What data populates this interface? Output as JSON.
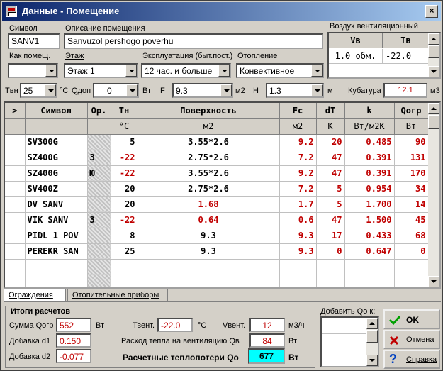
{
  "window": {
    "title": "Данные - Помещение",
    "close": "×"
  },
  "top": {
    "symbol_label": "Символ",
    "symbol_value": "SANV1",
    "desc_label": "Описание помещения",
    "desc_value": "Sanvuzol pershogo poverhu",
    "kak_label": "Как помещ.",
    "kak_value": "",
    "floor_label": "Этаж",
    "floor_value": "Этаж 1",
    "expl_label": "Эксплуатация (быт.пост.)",
    "expl_value": "12 час. и больше",
    "heat_label": "Отопление",
    "heat_value": "Конвективное"
  },
  "vent": {
    "title": "Воздух вентиляционный",
    "col1": "Vв",
    "col2": "Tв",
    "val1": "1.0 обм.",
    "val2": "-22.0"
  },
  "params": {
    "tvn_label": "Tвн",
    "tvn_value": "25",
    "tvn_unit": "°C",
    "qdop_label": "Qдоп",
    "qdop_value": "0",
    "qdop_unit": "Вт",
    "f_label": "F",
    "f_value": "9.3",
    "f_unit": "м2",
    "h_label": "H",
    "h_value": "1.3",
    "h_unit": "м",
    "kub_label": "Кубатура",
    "kub_value": "12.1",
    "kub_unit": "м3"
  },
  "table": {
    "headers": [
      ">",
      "Символ",
      "Ор.",
      "Tн",
      "Поверхность",
      "Fc",
      "dT",
      "k",
      "Qогр"
    ],
    "units": [
      "",
      "",
      "",
      "°C",
      "м2",
      "м2",
      "K",
      "Вт/м2K",
      "Вт"
    ],
    "rows": [
      {
        "symbol": "SV300G",
        "or": "",
        "tn": "5",
        "surface": "3.55*2.6",
        "fc": "9.2",
        "dt": "20",
        "k": "0.485",
        "q": "90"
      },
      {
        "symbol": "SZ400G",
        "or": "З",
        "tn": "-22",
        "surface": "2.75*2.6",
        "fc": "7.2",
        "dt": "47",
        "k": "0.391",
        "q": "131"
      },
      {
        "symbol": "SZ400G",
        "or": "Ю",
        "tn": "-22",
        "surface": "3.55*2.6",
        "fc": "9.2",
        "dt": "47",
        "k": "0.391",
        "q": "170"
      },
      {
        "symbol": "SV400Z",
        "or": "",
        "tn": "20",
        "surface": "2.75*2.6",
        "fc": "7.2",
        "dt": "5",
        "k": "0.954",
        "q": "34"
      },
      {
        "symbol": "DV SANV",
        "or": "",
        "tn": "20",
        "surface": "1.68",
        "fc": "1.7",
        "dt": "5",
        "k": "1.700",
        "q": "14"
      },
      {
        "symbol": "VIK SANV",
        "or": "З",
        "tn": "-22",
        "surface": "0.64",
        "fc": "0.6",
        "dt": "47",
        "k": "1.500",
        "q": "45"
      },
      {
        "symbol": "PIDL 1 POV",
        "or": "",
        "tn": "8",
        "surface": "9.3",
        "fc": "9.3",
        "dt": "17",
        "k": "0.433",
        "q": "68"
      },
      {
        "symbol": "PEREKR SAN",
        "or": "",
        "tn": "25",
        "surface": "9.3",
        "fc": "9.3",
        "dt": "0",
        "k": "0.647",
        "q": "0"
      }
    ]
  },
  "tabs": [
    "Ограждения",
    "Отопительные приборы"
  ],
  "totals": {
    "title": "Итоги расчетов",
    "sum_label": "Сумма Qогр",
    "sum_value": "552",
    "sum_unit": "Вт",
    "d1_label": "Добавка d1",
    "d1_value": "0.150",
    "d2_label": "Добавка d2",
    "d2_value": "-0.077",
    "tvent_label": "Твент.",
    "tvent_value": "-22.0",
    "tvent_unit": "°C",
    "vvent_label": "Vвент.",
    "vvent_value": "12",
    "vvent_unit": "м3/ч",
    "qv_label": "Расход тепла на вентиляцию Qв",
    "qv_value": "84",
    "qv_unit": "Вт",
    "qo_label": "Расчетные теплопотери Qо",
    "qo_value": "677",
    "qo_unit": "Вт"
  },
  "add": {
    "label": "Добавить Qо к:"
  },
  "buttons": {
    "ok": "OK",
    "cancel": "Отмена",
    "help": "Справка"
  }
}
